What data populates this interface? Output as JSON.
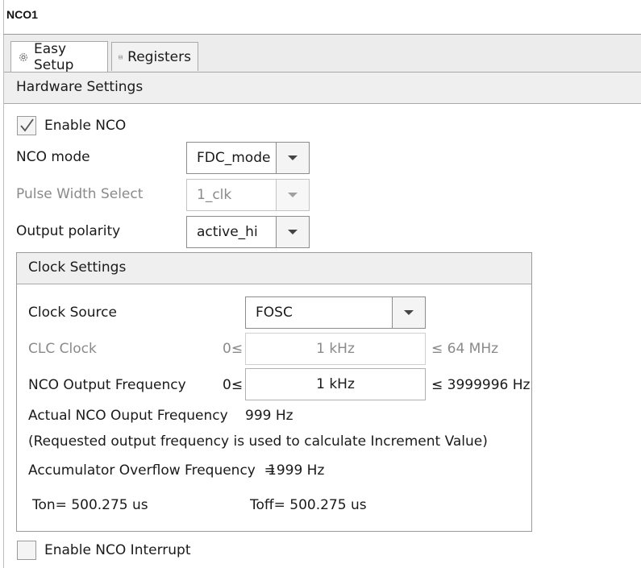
{
  "window": {
    "title": "NCO1"
  },
  "tabs": [
    {
      "label": "Easy Setup",
      "icon": "gear-icon",
      "active": true
    },
    {
      "label": "Registers",
      "icon": "list-icon",
      "active": false
    }
  ],
  "hardware_settings": {
    "title": "Hardware Settings",
    "enable_nco": {
      "label": "Enable NCO",
      "checked": true
    },
    "nco_mode": {
      "label": "NCO mode",
      "value": "FDC_mode"
    },
    "pulse_width_select": {
      "label": "Pulse Width Select",
      "value": "1_clk",
      "disabled": true
    },
    "output_polarity": {
      "label": "Output polarity",
      "value": "active_hi"
    }
  },
  "clock_settings": {
    "title": "Clock Settings",
    "clock_source": {
      "label": "Clock Source",
      "value": "FOSC"
    },
    "clc_clock": {
      "label": "CLC Clock",
      "min": "0≤",
      "value": "1 kHz",
      "max": "≤ 64 MHz",
      "disabled": true
    },
    "nco_output_frequency": {
      "label": "NCO Output Frequency",
      "min": "0≤",
      "value": "1 kHz",
      "max": "≤ 3999996 Hz"
    },
    "actual_frequency": {
      "label": "Actual NCO Ouput Frequency",
      "value": "999 Hz"
    },
    "note": "(Requested output frequency is used to calculate Increment Value)",
    "overflow": {
      "label": "Accumulator Overflow Frequency  =",
      "value": "1999 Hz"
    },
    "ton": "Ton= 500.275 us",
    "toff": "Toff= 500.275 us"
  },
  "enable_interrupt": {
    "label": "Enable NCO Interrupt",
    "checked": false
  },
  "colors": {
    "panel": "#efefef",
    "border": "#a8a8a8",
    "disabled_text": "#8a8a8a"
  }
}
